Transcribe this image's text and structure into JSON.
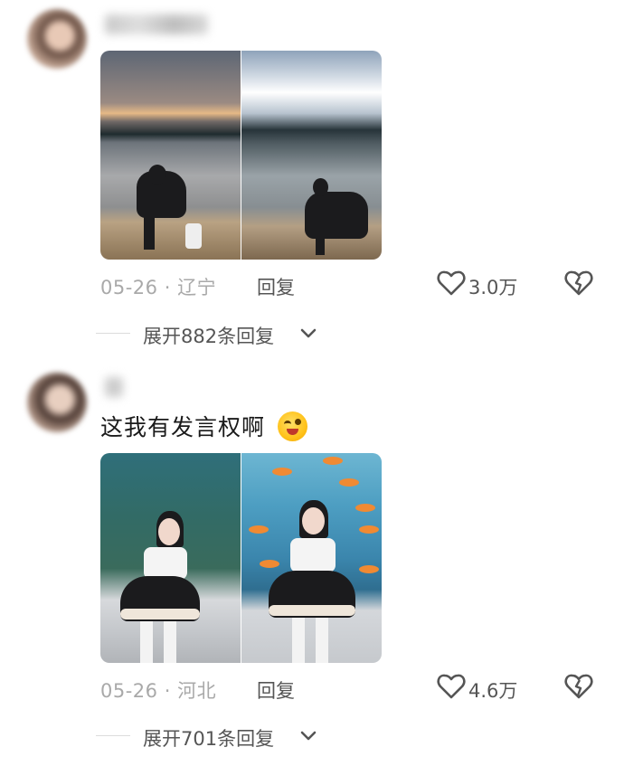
{
  "comments": [
    {
      "date": "05-26",
      "separator": "·",
      "location": "辽宁",
      "reply_label": "回复",
      "likes": "3.0万",
      "expand_label": "展开882条回复",
      "images": [
        "lakeside-sunset-photo",
        "snowy-mountain-lake-photo"
      ]
    },
    {
      "text": "这我有发言权啊",
      "emoji": "winking-tongue-emoji",
      "date": "05-26",
      "separator": "·",
      "location": "河北",
      "reply_label": "回复",
      "likes": "4.6万",
      "expand_label": "展开701条回复",
      "images": [
        "aquarium-dress-photo-1",
        "aquarium-dress-photo-2"
      ]
    }
  ],
  "colors": {
    "meta_gray": "#a9a9a9",
    "action_gray": "#555555",
    "text": "#1a1a1a"
  }
}
